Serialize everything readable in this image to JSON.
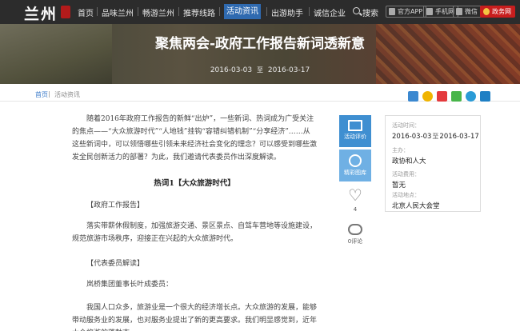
{
  "nav": {
    "logo": "兰州",
    "items": [
      "首页",
      "品味兰州",
      "畅游兰州",
      "推荐线路",
      "活动资讯",
      "出游助手",
      "诚信企业"
    ],
    "search": "搜索",
    "app": "官方APP",
    "mobile": "手机网",
    "wechat": "微信",
    "gov": "政务网"
  },
  "banner": {
    "title": "聚焦两会-政府工作报告新词透新意",
    "start": "2016-03-03",
    "to": "至",
    "end": "2016-03-17"
  },
  "breadcrumb": {
    "home": "首页",
    "sep": "|",
    "current": "活动资讯"
  },
  "article": {
    "intro": "随着2016年政府工作报告的新鲜“出炉”，一些新词、热词成为广受关注的焦点——“大众旅游时代”“人地钱”挂钩“容错纠错机制”“分享经济”……从这些新词中，可以领悟哪些引领未来经济社会变化的理念？可以感受到哪些激发全民创新活力的部署？为此，我们邀请代表委员作出深度解读。",
    "heading": "热词1【大众旅游时代】",
    "report_tag": "【政府工作报告】",
    "report_text": "落实带薪休假制度，加强旅游交通、景区景点、自驾车营地等设施建设，规范旅游市场秩序，迎接正在兴起的大众旅游时代。",
    "reading_tag": "【代表委员解读】",
    "speaker": "岚桥集团董事长叶成委员：",
    "body": "我国人口众多，旅游业是一个很大的经济增长点。大众旅游的发展，能够带动服务业的发展，也对服务业提出了新的更高要求。我们明显感觉到，近年大众旅游的蓬勃态"
  },
  "actions": {
    "review": "活动评价",
    "gallery": "精彩图库",
    "likes": "4",
    "comments": "0评论"
  },
  "info": {
    "time_label": "活动时间：",
    "start": "2016-03-03",
    "to": "至",
    "end": "2016-03-17",
    "organizer_label": "主办：",
    "organizer": "政协和人大",
    "cost_label": "活动费用：",
    "cost": "暂无",
    "venue_label": "活动地点：",
    "venue": "北京人民大会堂"
  },
  "colors": {
    "nav_bg": "#2c2c2c",
    "nav_active": "#2f6ab0",
    "action_blue": "#3f8fd1",
    "gov_red": "#c81e1e"
  }
}
